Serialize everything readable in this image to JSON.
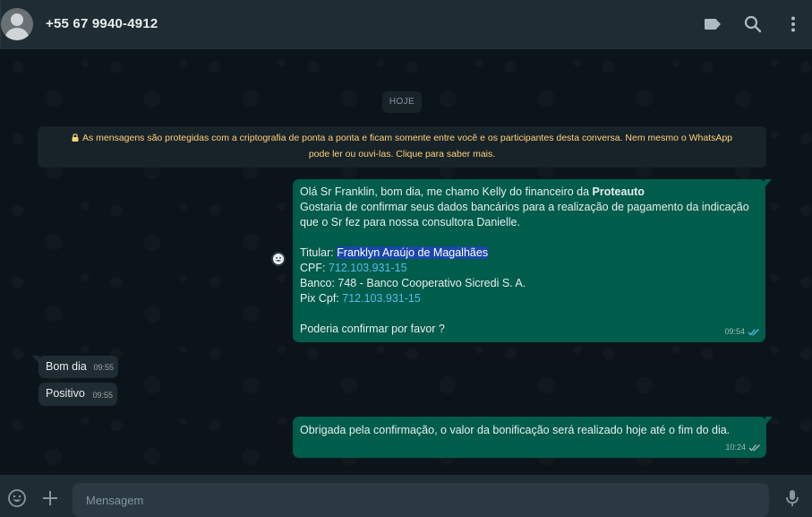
{
  "header": {
    "contact_name": "+55 67 9940-4912",
    "icons": [
      "label-icon",
      "search-icon",
      "menu-icon"
    ]
  },
  "chat": {
    "date_chip": "HOJE",
    "encryption_notice_line1": "As mensagens são protegidas com a criptografia de ponta a ponta e ficam somente entre você e os participantes desta conversa. Nem mesmo o WhatsApp",
    "encryption_notice_line2": "pode ler ou ouvi-las. Clique para saber mais.",
    "messages": [
      {
        "direction": "out",
        "line1_prefix": "Olá Sr Franklin, bom dia, me chamo Kelly do financeiro da ",
        "line1_bold": "Proteauto",
        "line2": "Gostaria de confirmar seus dados bancários para a realização de pagamento da indicação",
        "line3": "que o Sr fez para nossa consultora Danielle.",
        "titular_label": "Titular: ",
        "titular_value": "Franklyn Araújo de Magalhães",
        "cpf_label": "CPF: ",
        "cpf_value": "712.103.931-15",
        "banco_line": "Banco: 748 - Banco Cooperativo Sicredi S. A.",
        "pix_label": "Pix Cpf: ",
        "pix_value": "712.103.931-15",
        "closing": "Poderia confirmar por favor ?",
        "time": "09:54",
        "status": "read"
      },
      {
        "direction": "in",
        "text": "Bom dia",
        "time": "09:55"
      },
      {
        "direction": "in",
        "text": "Positivo",
        "time": "09:55"
      },
      {
        "direction": "out",
        "text": "Obrigada pela confirmação, o valor da bonificação será realizado hoje até o fim do dia.",
        "time": "10:24",
        "status": "delivered"
      }
    ]
  },
  "footer": {
    "input_placeholder": "Mensagem",
    "icons": [
      "emoji-icon",
      "attach-plus-icon",
      "microphone-icon"
    ]
  },
  "colors": {
    "header_bg": "#202c33",
    "chat_bg": "#0b141a",
    "outgoing_bubble": "#005c4b",
    "incoming_bubble": "#202c33",
    "notice_text": "#ffd279",
    "link": "#53bdeb",
    "read_ticks": "#53bdeb"
  }
}
